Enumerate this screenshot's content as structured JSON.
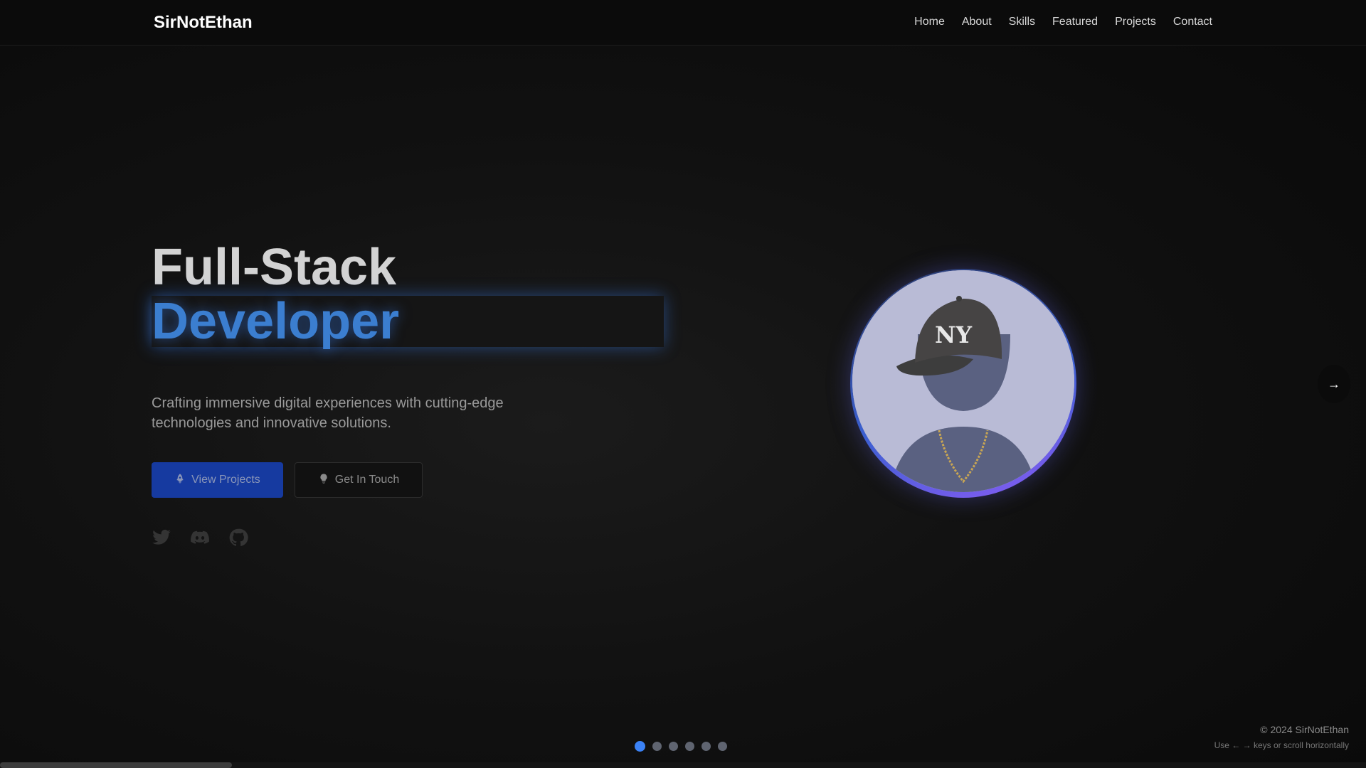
{
  "brand": "SirNotEthan",
  "nav": {
    "items": [
      "Home",
      "About",
      "Skills",
      "Featured",
      "Projects",
      "Contact"
    ]
  },
  "hero": {
    "title_line1": "Full-Stack",
    "title_line2": "Developer",
    "tagline": "Crafting immersive digital experiences with cutting-edge technologies and innovative solutions.",
    "primary_button": "View Projects",
    "secondary_button": "Get In Touch",
    "socials": [
      "twitter-icon",
      "discord-icon",
      "github-icon"
    ]
  },
  "carousel": {
    "next_label": "→",
    "dot_count": 6,
    "active_dot": 0
  },
  "footer": {
    "copyright": "© 2024 SirNotEthan",
    "hint": "Use ← → keys or scroll horizontally"
  },
  "horizontal_scroll_progress": 0.17,
  "colors": {
    "accent": "#3b82f6",
    "primary_button_bg": "#163aa0",
    "avatar_ring_start": "#3b5fd0",
    "avatar_ring_end": "#8b5cf6",
    "background": "#0e0e0e"
  }
}
